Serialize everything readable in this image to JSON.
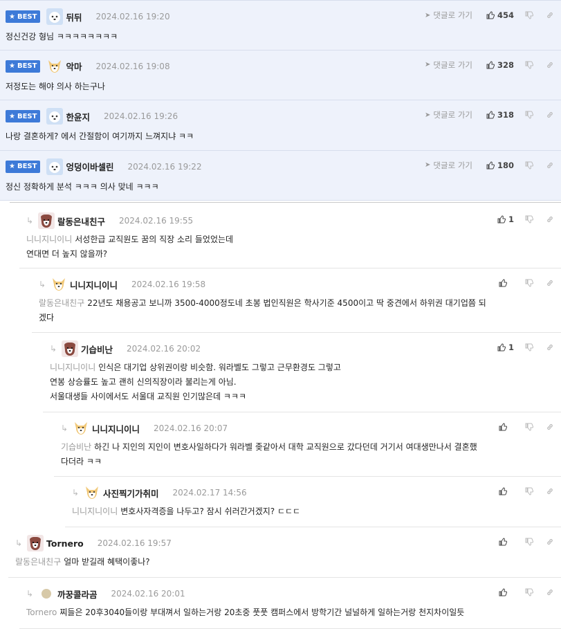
{
  "labels": {
    "best": "BEST",
    "reply_link": "댓글로 가기"
  },
  "best_comments": [
    {
      "nick": "뒤뒤",
      "date": "2024.02.16 19:20",
      "likes": "454",
      "text": "정신건강 형님 ㅋㅋㅋㅋㅋㅋㅋㅋ",
      "avatar": "white-dog-icon"
    },
    {
      "nick": "악마",
      "date": "2024.02.16 19:08",
      "likes": "328",
      "text": "저정도는 해야 의사 하는구나",
      "avatar": "yellow-dog-icon"
    },
    {
      "nick": "한윤지",
      "date": "2024.02.16 19:26",
      "likes": "318",
      "text": "나랑 결혼하게? 에서 간절함이 여기까지 느껴지냐 ㅋㅋ",
      "avatar": "white-dog-icon"
    },
    {
      "nick": "엉덩이바셀린",
      "date": "2024.02.16 19:22",
      "likes": "180",
      "text": "정신 정확하게 분석 ㅋㅋㅋ 의사 맞네 ㅋㅋㅋ",
      "avatar": "white-dog-icon"
    }
  ],
  "replies": [
    {
      "nick": "랄동은내친구",
      "date": "2024.02.16 19:55",
      "likes": "1",
      "mention": "니니지니이니",
      "lines": [
        "서성한급 교직원도 꿈의 직장 소리 들었었는데",
        "연대면 더 높지 않을까?"
      ],
      "avatar": "brown-dog-icon"
    },
    {
      "nick": "니니지니이니",
      "date": "2024.02.16 19:58",
      "likes": "",
      "mention": "랄동은내친구",
      "lines": [
        "22년도 채용공고 보니까 3500-4000정도네 초봉 법인직원은 학사기준 4500이고 딱 중견에서 하위권 대기업쯤 되",
        "겠다"
      ],
      "avatar": "yellow-dog-icon"
    },
    {
      "nick": "기습비난",
      "date": "2024.02.16 20:02",
      "likes": "1",
      "mention": "니니지니이니",
      "lines": [
        "인식은 대기업 상위권이랑 비슷함. 워라벨도 그렇고 근무환경도 그렇고",
        "연봉 상승률도 높고 괜히 신의직장이라 불리는게 아님.",
        "서울대생들 사이에서도 서울대 교직원 인기많은데 ㅋㅋㅋ"
      ],
      "avatar": "brown-dog-icon"
    },
    {
      "nick": "니니지니이니",
      "date": "2024.02.16 20:07",
      "likes": "",
      "mention": "기습비난",
      "lines": [
        "하긴 나 지인의 지인이 변호사일하다가 워라벨 좆같아서 대학 교직원으로 갔다던데 거기서 여대생만나서 결혼했",
        "다더라 ㅋㅋ"
      ],
      "avatar": "yellow-dog-icon"
    },
    {
      "nick": "사진찍기가취미",
      "date": "2024.02.17 14:56",
      "likes": "",
      "mention": "니니지니이니",
      "lines": [
        "변호사자격증을 나두고? 잠시 쉬러간거겠지? ㄷㄷㄷ"
      ],
      "avatar": "yellow-dog-icon"
    },
    {
      "nick": "Tornero",
      "date": "2024.02.16 19:57",
      "likes": "",
      "mention": "랄동은내친구",
      "lines": [
        "얼마 받길래 혜택이좋나?"
      ],
      "avatar": "brown-dog-icon"
    },
    {
      "nick": "까꿍콜라곰",
      "date": "2024.02.16 20:01",
      "likes": "",
      "mention": "Tornero",
      "lines": [
        "찌들은 20후3040들이랑 부대껴서 일하는거랑 20초중 풋풋 캠퍼스에서 방학기간 널널하게 일하는거랑 천지차이일듯"
      ],
      "avatar": "circle-avatar-icon"
    }
  ],
  "colors": {
    "best_bg": "#eef2fb",
    "badge": "#3d7ad8",
    "mention": "#9a9a9a"
  }
}
